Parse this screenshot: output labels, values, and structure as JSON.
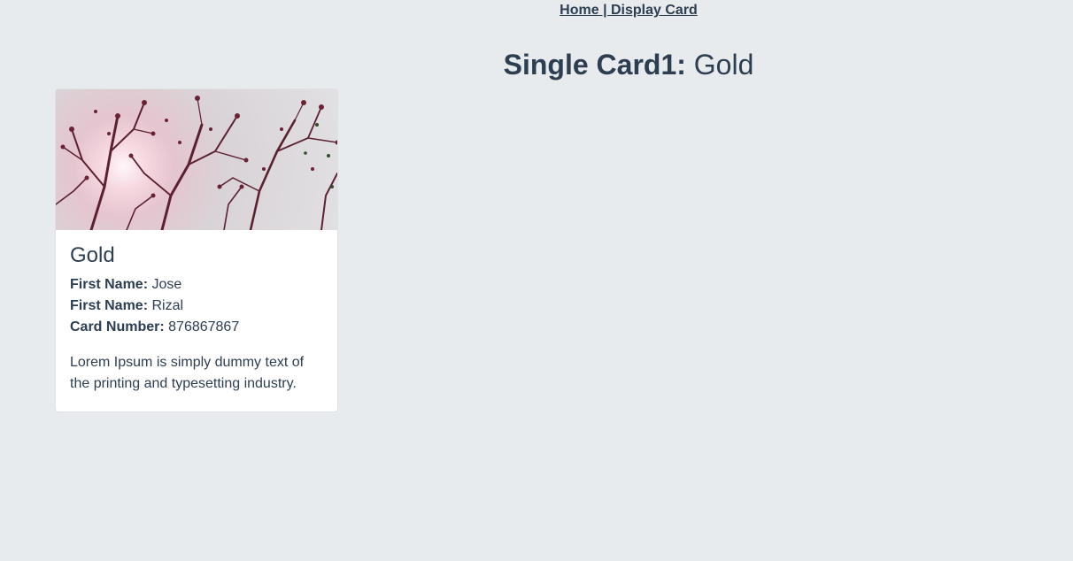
{
  "nav": {
    "home_label": "Home",
    "separator": " | ",
    "display_card_label": "Display Card"
  },
  "header": {
    "title_prefix": "Single Card1:",
    "title_value": "Gold"
  },
  "card": {
    "image_icon": "tree-branches-photo",
    "title": "Gold",
    "fields": [
      {
        "label": "First Name:",
        "value": "Jose"
      },
      {
        "label": "First Name:",
        "value": "Rizal"
      },
      {
        "label": "Card Number:",
        "value": "876867867"
      }
    ],
    "description": "Lorem Ipsum is simply dummy text of the printing and typesetting industry."
  },
  "colors": {
    "background": "#e8ebee",
    "text": "#2c3e50",
    "card": "#ffffff"
  }
}
